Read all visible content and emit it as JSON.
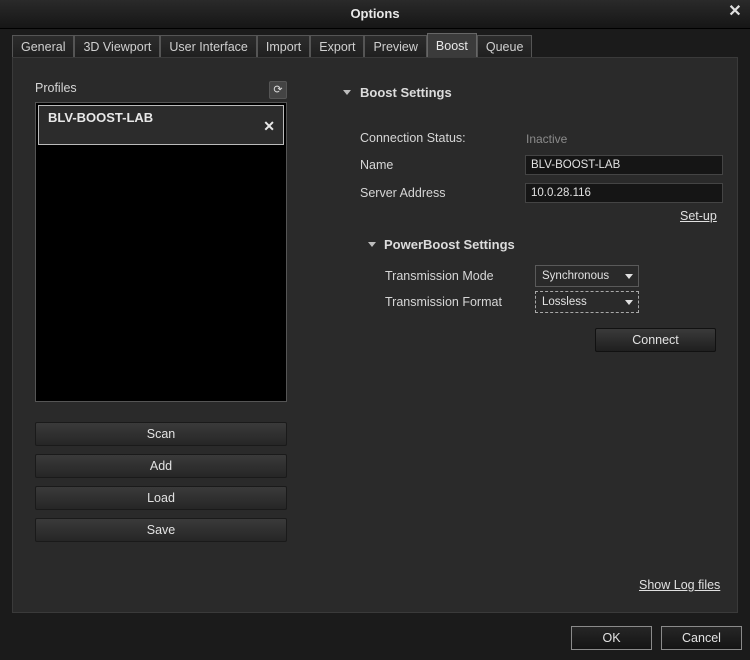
{
  "window": {
    "title": "Options"
  },
  "tabs": [
    {
      "label": "General",
      "active": false
    },
    {
      "label": "3D Viewport",
      "active": false
    },
    {
      "label": "User Interface",
      "active": false
    },
    {
      "label": "Import",
      "active": false
    },
    {
      "label": "Export",
      "active": false
    },
    {
      "label": "Preview",
      "active": false
    },
    {
      "label": "Boost",
      "active": true
    },
    {
      "label": "Queue",
      "active": false
    }
  ],
  "profiles": {
    "label": "Profiles",
    "items": [
      {
        "name": "BLV-BOOST-LAB"
      }
    ],
    "buttons": {
      "scan": "Scan",
      "add": "Add",
      "load": "Load",
      "save": "Save"
    }
  },
  "boost_settings": {
    "heading": "Boost Settings",
    "connection_status_label": "Connection Status:",
    "connection_status_value": "Inactive",
    "name_label": "Name",
    "name_value": "BLV-BOOST-LAB",
    "server_address_label": "Server Address",
    "server_address_value": "10.0.28.116",
    "setup_link": "Set-up"
  },
  "powerboost_settings": {
    "heading": "PowerBoost Settings",
    "transmission_mode_label": "Transmission Mode",
    "transmission_mode_value": "Synchronous",
    "transmission_format_label": "Transmission Format",
    "transmission_format_value": "Lossless"
  },
  "connect_button": "Connect",
  "show_log_link": "Show Log files",
  "dialog_buttons": {
    "ok": "OK",
    "cancel": "Cancel"
  },
  "colors": {
    "background": "#1b1b1b",
    "panel": "#2a2a2a",
    "list_bg": "#000000",
    "inactive_status": "#8b8b8b"
  }
}
